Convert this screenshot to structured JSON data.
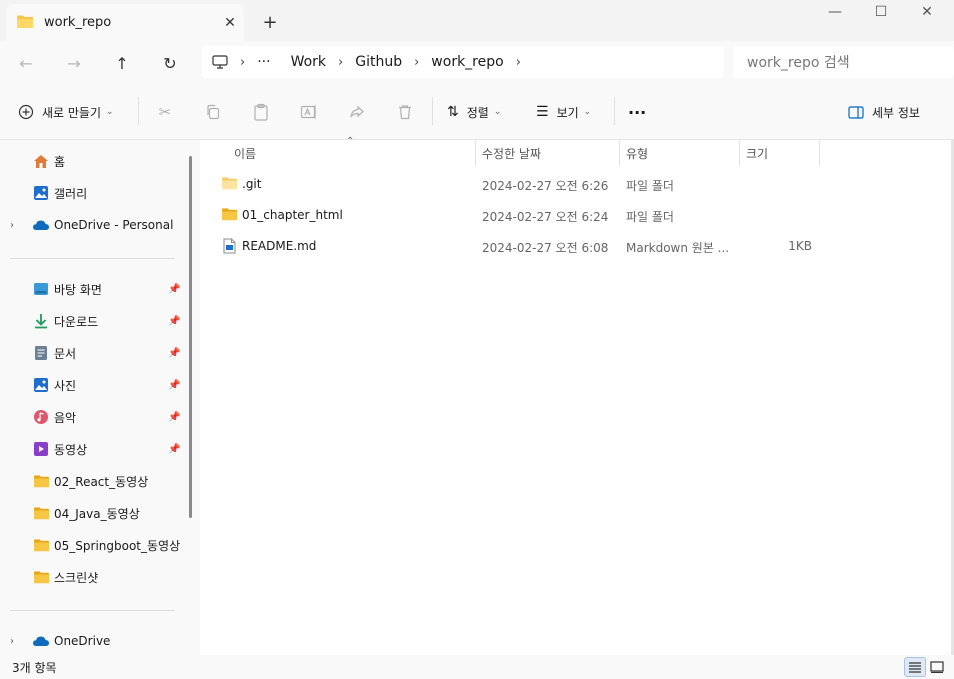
{
  "tab": {
    "title": "work_repo",
    "close": "✕",
    "new_tab": "+"
  },
  "window": {
    "minimize": "—",
    "maximize": "☐",
    "close": "✕"
  },
  "nav": {
    "back": "←",
    "forward": "→",
    "up": "↑",
    "refresh": "↻"
  },
  "breadcrumb": {
    "more": "···",
    "items": [
      "Work",
      "Github",
      "work_repo"
    ],
    "sep": "›"
  },
  "search": {
    "placeholder": "work_repo 검색"
  },
  "toolbar": {
    "new_label": "새로 만들기",
    "sort_label": "정렬",
    "view_label": "보기",
    "more_label": "···",
    "details_label": "세부 정보"
  },
  "sidebar": {
    "top": [
      {
        "label": "홈",
        "icon": "home-icon"
      },
      {
        "label": "갤러리",
        "icon": "gallery-icon"
      },
      {
        "label": "OneDrive - Personal",
        "icon": "cloud-icon",
        "expandable": true
      }
    ],
    "pinned": [
      {
        "label": "바탕 화면",
        "icon": "desktop-icon"
      },
      {
        "label": "다운로드",
        "icon": "download-icon"
      },
      {
        "label": "문서",
        "icon": "document-icon"
      },
      {
        "label": "사진",
        "icon": "picture-icon"
      },
      {
        "label": "음악",
        "icon": "music-icon"
      },
      {
        "label": "동영상",
        "icon": "video-icon"
      }
    ],
    "folders": [
      {
        "label": "02_React_동영상"
      },
      {
        "label": "04_Java_동영상"
      },
      {
        "label": "05_Springboot_동영상"
      },
      {
        "label": "스크린샷"
      }
    ],
    "bottom": [
      {
        "label": "OneDrive",
        "icon": "cloud-icon",
        "expandable": true
      }
    ]
  },
  "columns": {
    "name": "이름",
    "date": "수정한 날짜",
    "type": "유형",
    "size": "크기"
  },
  "files": [
    {
      "name": ".git",
      "date": "2024-02-27 오전 6:26",
      "type": "파일 폴더",
      "size": "",
      "kind": "folder"
    },
    {
      "name": "01_chapter_html",
      "date": "2024-02-27 오전 6:24",
      "type": "파일 폴더",
      "size": "",
      "kind": "folder"
    },
    {
      "name": "README.md",
      "date": "2024-02-27 오전 6:08",
      "type": "Markdown 원본 ...",
      "size": "1KB",
      "kind": "file"
    }
  ],
  "status": {
    "count": "3개 항목"
  },
  "colors": {
    "folder": "#F6C744",
    "folder_dark": "#E8A91E",
    "accent": "#0067C0",
    "onedrive": "#0F6CBD"
  }
}
